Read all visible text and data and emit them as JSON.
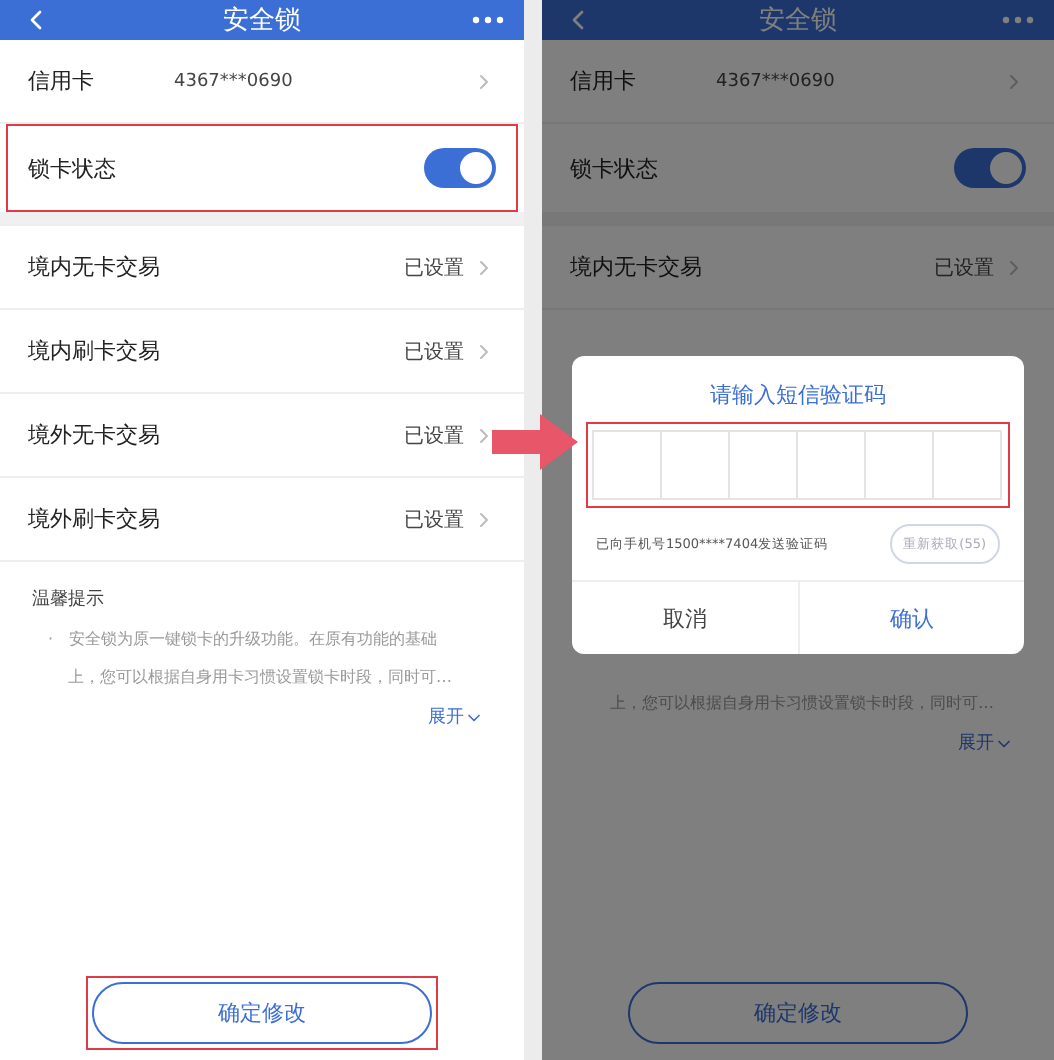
{
  "screens": [
    {
      "nav": {
        "title": "安全锁"
      },
      "card": {
        "label": "信用卡",
        "number": "4367***0690"
      },
      "lock": {
        "label": "锁卡状态",
        "on": true,
        "highlighted": true
      },
      "rows": [
        {
          "label": "境内无卡交易",
          "status": "已设置"
        },
        {
          "label": "境内刷卡交易",
          "status": "已设置"
        },
        {
          "label": "境外无卡交易",
          "status": "已设置"
        },
        {
          "label": "境外刷卡交易",
          "status": "已设置"
        }
      ],
      "tips": {
        "title": "温馨提示",
        "bullet": "·",
        "lines": [
          "安全锁为原一键锁卡的升级功能。在原有功能的基础",
          "上，您可以根据自身用卡习惯设置锁卡时段，同时可…"
        ]
      },
      "expand": "展开",
      "confirm_button": {
        "label": "确定修改",
        "highlighted": true
      }
    },
    {
      "nav": {
        "title": "安全锁"
      },
      "card": {
        "label": "信用卡",
        "number": "4367***0690"
      },
      "lock": {
        "label": "锁卡状态",
        "on": true,
        "highlighted": false
      },
      "rows": [
        {
          "label": "境内无卡交易",
          "status": "已设置"
        }
      ],
      "tips": {
        "lines": [
          "上，您可以根据自身用卡习惯设置锁卡时段，同时可…"
        ]
      },
      "expand": "展开",
      "confirm_button": {
        "label": "确定修改",
        "highlighted": false
      },
      "dialog": {
        "title": "请输入短信验证码",
        "code_highlighted": true,
        "code_cells": [
          {
            "kind": "empty"
          },
          {
            "kind": "empty"
          },
          {
            "kind": "empty"
          },
          {
            "kind": "empty"
          },
          {
            "kind": "empty"
          },
          {
            "kind": "empty"
          }
        ],
        "sent_text": "已向手机号1500****7404发送验证码",
        "resend_button": "重新获取(55)",
        "cancel": "取消",
        "confirm": "确认"
      }
    }
  ]
}
